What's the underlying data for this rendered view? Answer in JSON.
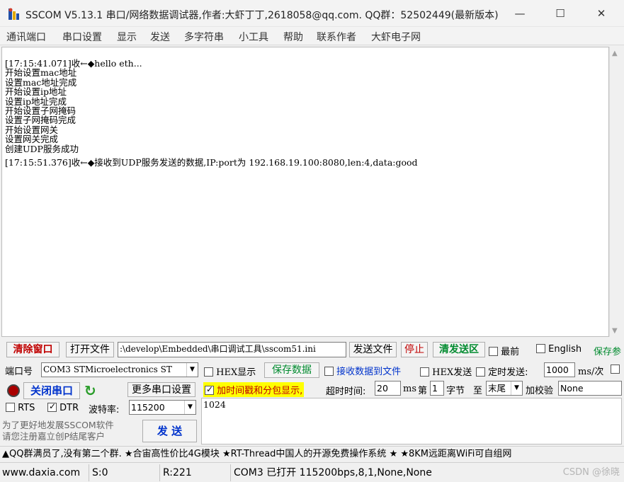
{
  "window": {
    "title": "SSCOM V5.13.1 串口/网络数据调试器,作者:大虾丁丁,2618058@qq.com. QQ群：52502449(最新版本)",
    "minimize": "—",
    "maximize": "☐",
    "close": "✕"
  },
  "menu": [
    "通讯端口",
    "串口设置",
    "显示",
    "发送",
    "多字符串",
    "小工具",
    "帮助",
    "联系作者",
    "大虾电子网"
  ],
  "receive": {
    "lines": [
      "[17:15:41.071]收←◆hello eth...",
      "开始设置mac地址",
      "设置mac地址完成",
      "开始设置ip地址",
      "设置ip地址完成",
      "开始设置子网掩码",
      "设置子网掩码完成",
      "开始设置网关",
      "设置网关完成",
      "创建UDP服务成功",
      "",
      "[17:15:51.376]收←◆接收到UDP服务发送的数据,IP:port为 192.168.19.100:8080,len:4,data:good"
    ]
  },
  "toolbar": {
    "clear_window": "清除窗口",
    "open_file": "打开文件",
    "file_path": ":\\develop\\Embedded\\串口调试工具\\sscom51.ini",
    "send_file": "发送文件",
    "stop": "停止",
    "clear_send": "清发送区",
    "topmost": "最前",
    "english": "English",
    "save_params": "保存参"
  },
  "port_row": {
    "port_label": "端口号",
    "port_value": "COM3 STMicroelectronics ST",
    "hex_display": "HEX显示",
    "save_data": "保存数据",
    "recv_to_file": "接收数据到文件",
    "hex_send": "HEX发送",
    "timed_send": "定时发送:",
    "interval": "1000",
    "interval_unit": "ms/次"
  },
  "control_row": {
    "close_port": "关闭串口",
    "more_settings": "更多串口设置",
    "timestamp": "加时间戳和分包显示,",
    "timeout_label": "超时时间:",
    "timeout_value": "20",
    "timeout_unit": "ms",
    "byte_prefix": "第",
    "byte_index": "1",
    "byte_suffix": "字节",
    "to_label": "至",
    "to_value": "末尾",
    "checksum_label": "加校验",
    "checksum_value": "None"
  },
  "baud_row": {
    "rts": "RTS",
    "dtr": "DTR",
    "baud_label": "波特率:",
    "baud_value": "115200"
  },
  "send": {
    "text": "1024",
    "send_button": "发 送",
    "promo_line1": "为了更好地发展SSCOM软件",
    "promo_line2": "请您注册嘉立创P结尾客户"
  },
  "marquee": "▲QQ群满员了,没有第二个群. ★合宙高性价比4G模块 ★RT-Thread中国人的开源免费操作系统 ★ ★8KM远距离WiFi可自组网",
  "status": {
    "website": "www.daxia.com",
    "sent": "S:0",
    "received": "R:221",
    "port_state": "COM3 已打开  115200bps,8,1,None,None"
  },
  "watermark": "CSDN @徐晓",
  "colors": {
    "accent_red": "#c00000",
    "accent_green": "#008a2e",
    "highlight_yellow": "#ffff00"
  }
}
